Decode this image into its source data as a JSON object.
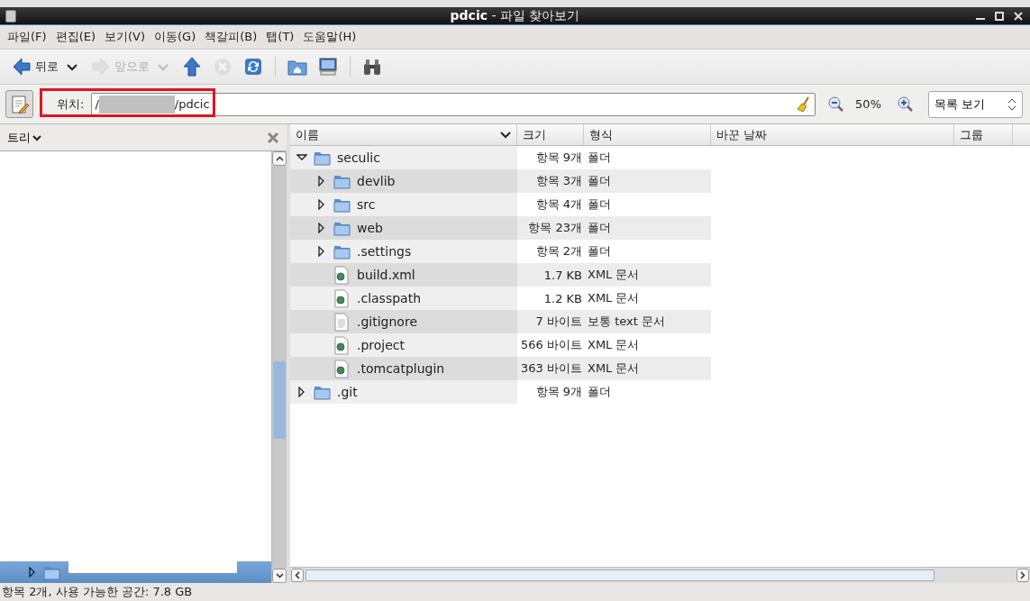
{
  "window": {
    "title": "**pdcic** - 파일 찾아보기"
  },
  "menu": [
    "파일(F)",
    "편집(E)",
    "보기(V)",
    "이동(G)",
    "책갈피(B)",
    "탭(T)",
    "도움말(H)"
  ],
  "toolbar": [
    {
      "kind": "back",
      "label": "뒤로",
      "disabled": false,
      "dropdown": true
    },
    {
      "kind": "forward",
      "label": "앞으로",
      "disabled": true,
      "dropdown": true
    },
    {
      "kind": "up",
      "disabled": false
    },
    {
      "kind": "stop",
      "disabled": true
    },
    {
      "kind": "reload",
      "disabled": false
    },
    {
      "kind": "separator"
    },
    {
      "kind": "home",
      "disabled": false
    },
    {
      "kind": "computer",
      "disabled": false
    },
    {
      "kind": "separator"
    },
    {
      "kind": "search",
      "disabled": false
    }
  ],
  "location": {
    "label": "위치:",
    "prefix": "/",
    "suffix": "/pdcic",
    "zoom": "50%",
    "view": "목록 보기"
  },
  "sidebar": {
    "title": "트리",
    "items": [
      {
        "selected": true,
        "expanded": false
      }
    ]
  },
  "columns": [
    "이름",
    "크기",
    "형식",
    "바꾼 날짜",
    "그룹"
  ],
  "files": [
    {
      "name": "seculic",
      "kind": "folder",
      "size": "항목 9개",
      "type": "폴더",
      "expanded": true,
      "children": [
        {
          "name": "devlib",
          "kind": "folder",
          "size": "항목 3개",
          "type": "폴더",
          "expanded": false
        },
        {
          "name": "src",
          "kind": "folder",
          "size": "항목 4개",
          "type": "폴더",
          "expanded": false
        },
        {
          "name": "web",
          "kind": "folder",
          "size": "항목 23개",
          "type": "폴더",
          "expanded": false
        },
        {
          "name": ".settings",
          "kind": "folder",
          "size": "항목 2개",
          "type": "폴더",
          "expanded": false
        },
        {
          "name": "build.xml",
          "kind": "xml",
          "size": "1.7 KB",
          "type": "XML 문서"
        },
        {
          "name": ".classpath",
          "kind": "xml",
          "size": "1.2 KB",
          "type": "XML 문서"
        },
        {
          "name": ".gitignore",
          "kind": "text",
          "size": "7 바이트",
          "type": "보통 text 문서"
        },
        {
          "name": ".project",
          "kind": "xml",
          "size": "566 바이트",
          "type": "XML 문서"
        },
        {
          "name": ".tomcatplugin",
          "kind": "xml",
          "size": "363 바이트",
          "type": "XML 문서"
        }
      ]
    },
    {
      "name": ".git",
      "kind": "folder",
      "size": "항목 9개",
      "type": "폴더",
      "expanded": false
    }
  ],
  "status_bar": "항목 2개, 사용 가능한 공간: 7.8 GB"
}
